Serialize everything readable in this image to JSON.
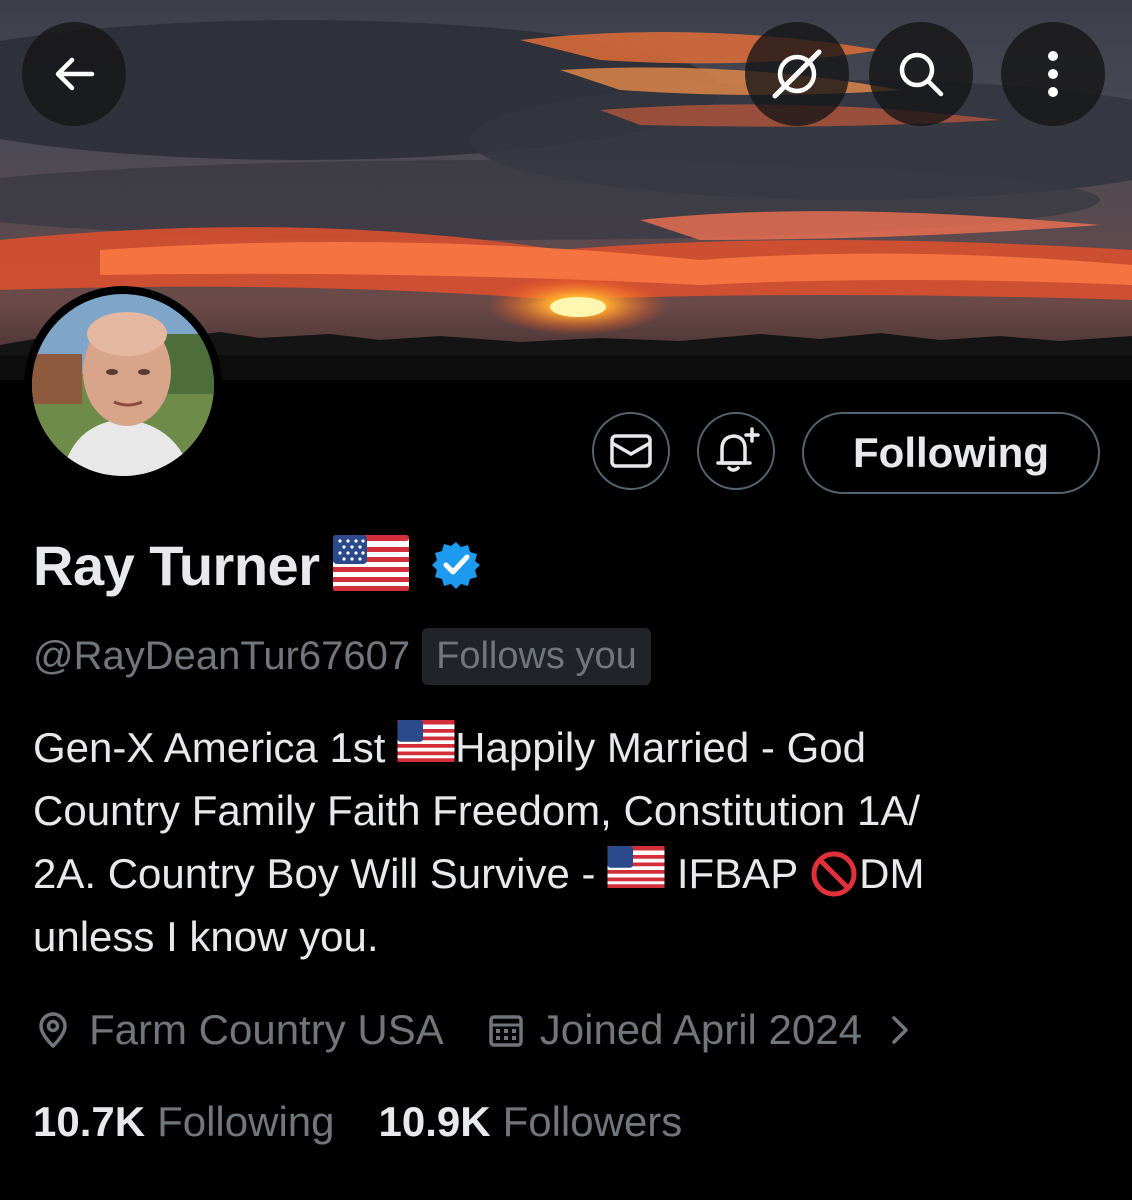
{
  "profile": {
    "display_name": "Ray Turner",
    "handle": "@RayDeanTur67607",
    "follows_badge": "Follows you",
    "verified": true,
    "bio_lines": [
      [
        "Gen-X America 1st ",
        "flag",
        "Happily Married - God"
      ],
      [
        "Country Family Faith Freedom, Constitution 1A/"
      ],
      [
        "2A. Country Boy Will Survive - ",
        "flag",
        " IFBAP ",
        "no-entry",
        "DM"
      ],
      [
        "unless I know you."
      ]
    ],
    "location": "Farm Country USA",
    "joined": "Joined April 2024",
    "following_count": "10.7K",
    "following_label": "Following",
    "followers_count": "10.9K",
    "followers_label": "Followers"
  },
  "actions": {
    "following_button": "Following"
  },
  "icons": {
    "back": "arrow-left-icon",
    "grok": "grok-icon",
    "search": "search-icon",
    "more": "more-vertical-icon",
    "message": "envelope-icon",
    "notify": "bell-plus-icon",
    "verified": "verified-badge-icon",
    "location": "location-pin-icon",
    "calendar": "calendar-icon",
    "chevron": "chevron-right-icon"
  },
  "colors": {
    "background": "#000000",
    "text_primary": "#e7e9ea",
    "text_secondary": "#71767b",
    "verified_blue": "#1d9bf0",
    "border": "#536471"
  }
}
